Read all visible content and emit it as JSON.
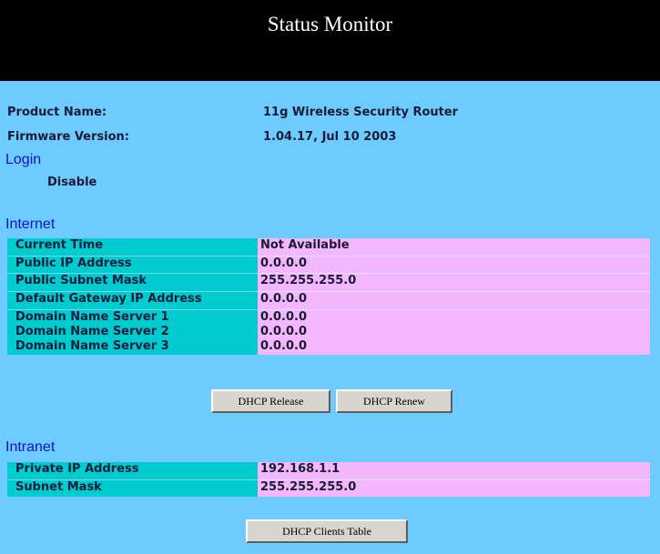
{
  "header": {
    "title": "Status Monitor"
  },
  "product": {
    "name_label": "Product Name:",
    "name_value": "11g Wireless Security Router",
    "firmware_label": "Firmware Version:",
    "firmware_value": "1.04.17, Jul 10 2003"
  },
  "login": {
    "heading": "Login",
    "status": "Disable"
  },
  "internet": {
    "heading": "Internet",
    "rows": [
      {
        "label": "Current Time",
        "value": "Not Available"
      },
      {
        "label": "Public IP Address",
        "value": "0.0.0.0"
      },
      {
        "label": "Public Subnet Mask",
        "value": "255.255.255.0"
      },
      {
        "label": "Default Gateway IP Address",
        "value": "0.0.0.0"
      },
      {
        "label": "Domain Name Server 1",
        "value": "0.0.0.0"
      },
      {
        "label": "Domain Name Server 2",
        "value": "0.0.0.0"
      },
      {
        "label": "Domain Name Server 3",
        "value": "0.0.0.0"
      }
    ],
    "release_button": "DHCP Release",
    "renew_button": "DHCP Renew"
  },
  "intranet": {
    "heading": "Intranet",
    "rows": [
      {
        "label": "Private IP Address",
        "value": "192.168.1.1"
      },
      {
        "label": "Subnet Mask",
        "value": "255.255.255.0"
      }
    ],
    "clients_button": "DHCP Clients Table"
  },
  "colors": {
    "page_bg": "#6ecbff",
    "header_bg": "#000000",
    "label_cell": "#00cccf",
    "value_cell": "#f2b7ff",
    "section_heading": "#1010c8"
  }
}
